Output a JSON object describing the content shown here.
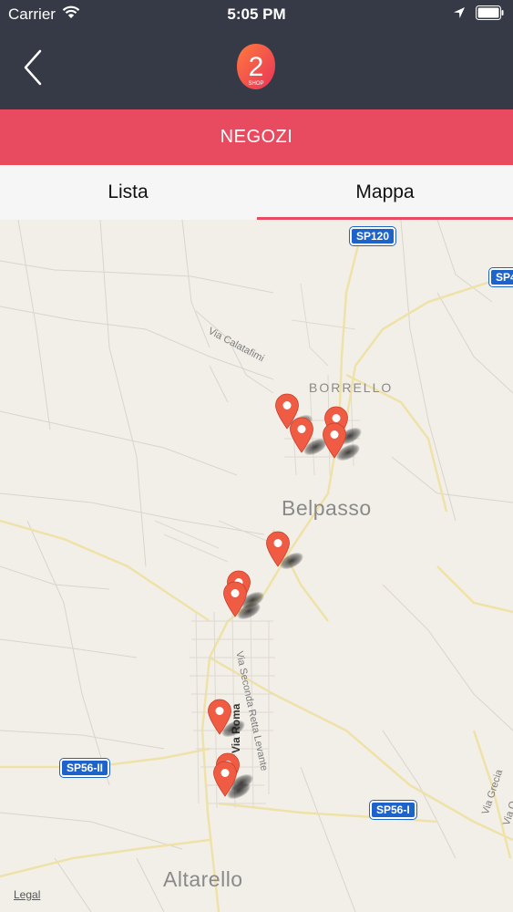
{
  "status_bar": {
    "carrier": "Carrier",
    "time": "5:05 PM"
  },
  "nav": {
    "logo_number": "2",
    "logo_text": "SHOP"
  },
  "header": {
    "title": "NEGOZI"
  },
  "tabs": [
    {
      "label": "Lista",
      "selected": false
    },
    {
      "label": "Mappa",
      "selected": true
    }
  ],
  "map": {
    "road_shields": [
      "SP120",
      "SP4",
      "SP56-II",
      "SP56-I"
    ],
    "places": [
      "BORRELLO",
      "Belpasso",
      "Altarello"
    ],
    "streets": [
      "Via Calatafimi",
      "Via Seconda Retta Levante",
      "Via Roma",
      "Via Grecia",
      "Via O"
    ],
    "legal": "Legal",
    "pin_count": 10
  },
  "colors": {
    "nav_bg": "#363a47",
    "accent": "#e84a5f",
    "pin": "#ef5b43",
    "shield": "#1d63c9",
    "map_bg": "#f2efe8"
  }
}
